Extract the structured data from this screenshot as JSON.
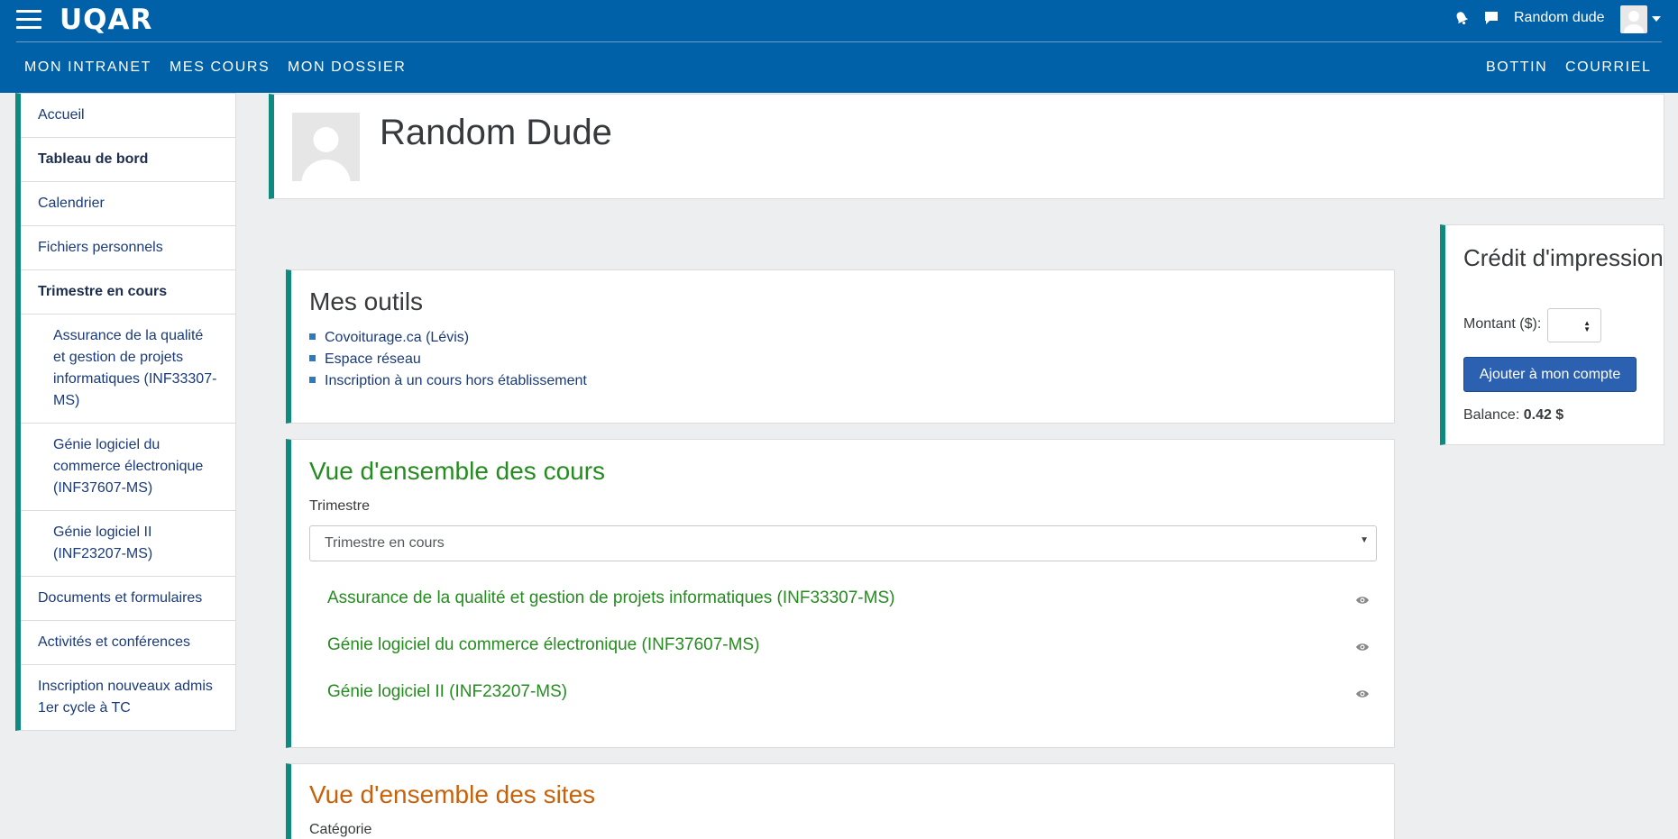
{
  "app": {
    "logo": "UQAR",
    "user_name": "Random dude"
  },
  "nav": {
    "left": [
      "MON INTRANET",
      "MES COURS",
      "MON DOSSIER"
    ],
    "right": [
      "BOTTIN",
      "COURRIEL"
    ]
  },
  "sidebar": {
    "items": [
      {
        "label": "Accueil"
      },
      {
        "label": "Tableau de bord"
      },
      {
        "label": "Calendrier"
      },
      {
        "label": "Fichiers personnels"
      },
      {
        "label": "Trimestre en cours"
      },
      {
        "label": "Assurance de la qualité et gestion de projets informatiques (INF33307-MS)"
      },
      {
        "label": "Génie logiciel du commerce électronique (INF37607-MS)"
      },
      {
        "label": "Génie logiciel II (INF23207-MS)"
      },
      {
        "label": "Documents et formulaires"
      },
      {
        "label": "Activités et conférences"
      },
      {
        "label": "Inscription nouveaux admis 1er cycle à TC"
      }
    ]
  },
  "profile": {
    "name": "Random Dude"
  },
  "outils": {
    "title": "Mes outils",
    "items": [
      "Covoiturage.ca (Lévis)",
      "Espace réseau",
      "Inscription à un cours hors établissement"
    ]
  },
  "cours": {
    "title": "Vue d'ensemble des cours",
    "filter_label": "Trimestre",
    "filter_value": "Trimestre en cours",
    "courses": [
      "Assurance de la qualité et gestion de projets informatiques (INF33307-MS)",
      "Génie logiciel du commerce électronique (INF37607-MS)",
      "Génie logiciel II (INF23207-MS)"
    ]
  },
  "sites": {
    "title": "Vue d'ensemble des sites",
    "filter_label": "Catégorie"
  },
  "credit": {
    "title": "Crédit d'impression",
    "montant_label": "Montant ($):",
    "button_label": "Ajouter à mon compte",
    "balance_label": "Balance:",
    "balance_value": "0.42 $"
  },
  "colors": {
    "topbar": "#0061a8",
    "accent_teal": "#0f8a80",
    "cours_title": "#258c1f",
    "sites_title": "#c8620a",
    "button": "#2c61b2"
  },
  "icons": [
    "menu-icon",
    "bell-icon",
    "chat-icon",
    "user-avatar-icon",
    "eye-icon"
  ]
}
